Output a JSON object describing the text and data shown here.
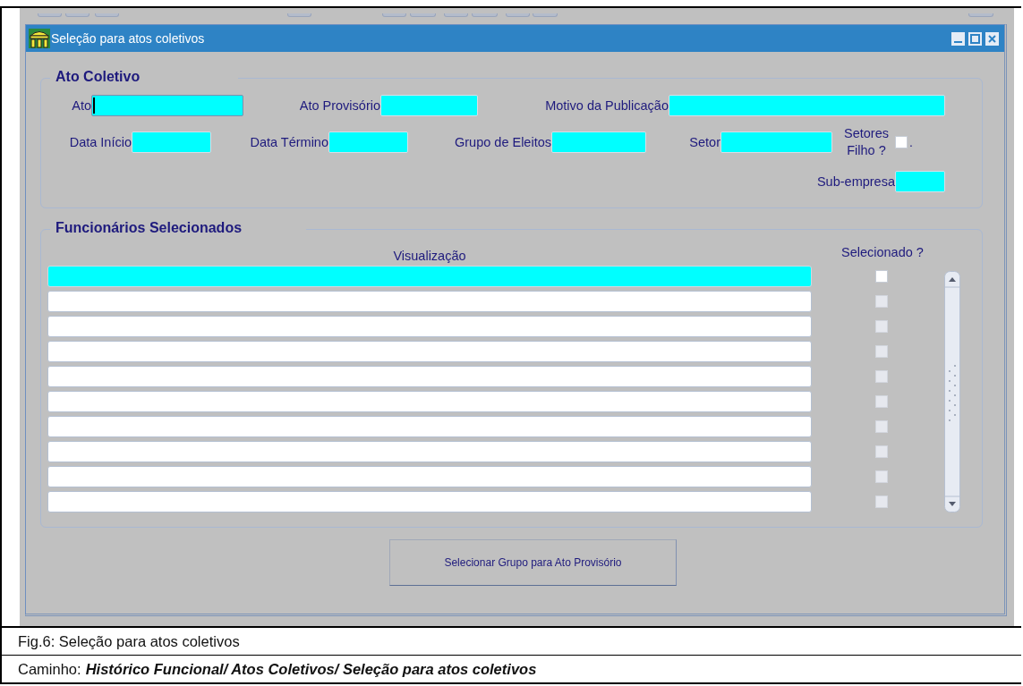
{
  "window": {
    "title": "Seleção para atos coletivos"
  },
  "ato_coletivo": {
    "legend": "Ato Coletivo",
    "field_rows": [
      {
        "fields": [
          {
            "kind": "text",
            "label": "Ato",
            "focused": true
          },
          {
            "kind": "text",
            "label": "Ato Provisório",
            "focused": false
          },
          {
            "kind": "text",
            "label": "Motivo da Publicação",
            "focused": false
          }
        ]
      },
      {
        "fields": [
          {
            "kind": "text",
            "label": "Data Início",
            "focused": false
          },
          {
            "kind": "text",
            "label": "Data Término",
            "focused": false
          },
          {
            "kind": "text",
            "label": "Grupo de Eleitos",
            "focused": false
          },
          {
            "kind": "text",
            "label": "Setor",
            "focused": false
          },
          {
            "kind": "checkbox",
            "label": "Setores Filho ?",
            "checked": false,
            "suffix": "."
          }
        ]
      },
      {
        "fields": [
          {
            "kind": "text",
            "label": "Sub-empresa",
            "focused": false
          }
        ]
      }
    ]
  },
  "funcionarios": {
    "legend": "Funcionários Selecionados",
    "columns": [
      "Visualização",
      "Selecionado ?"
    ],
    "rows": [
      {
        "current": true,
        "checked": false,
        "disabled": false
      },
      {
        "current": false,
        "checked": false,
        "disabled": true
      },
      {
        "current": false,
        "checked": false,
        "disabled": true
      },
      {
        "current": false,
        "checked": false,
        "disabled": true
      },
      {
        "current": false,
        "checked": false,
        "disabled": true
      },
      {
        "current": false,
        "checked": false,
        "disabled": true
      },
      {
        "current": false,
        "checked": false,
        "disabled": true
      },
      {
        "current": false,
        "checked": false,
        "disabled": true
      },
      {
        "current": false,
        "checked": false,
        "disabled": true
      },
      {
        "current": false,
        "checked": false,
        "disabled": true
      }
    ]
  },
  "button": "Selecionar Grupo para Ato Provisório",
  "caption": {
    "figure": "Fig.6: Seleção para atos coletivos",
    "path_label": "Caminho:",
    "path": "Histórico Funcional/ Atos Coletivos/ Seleção para atos coletivos"
  }
}
